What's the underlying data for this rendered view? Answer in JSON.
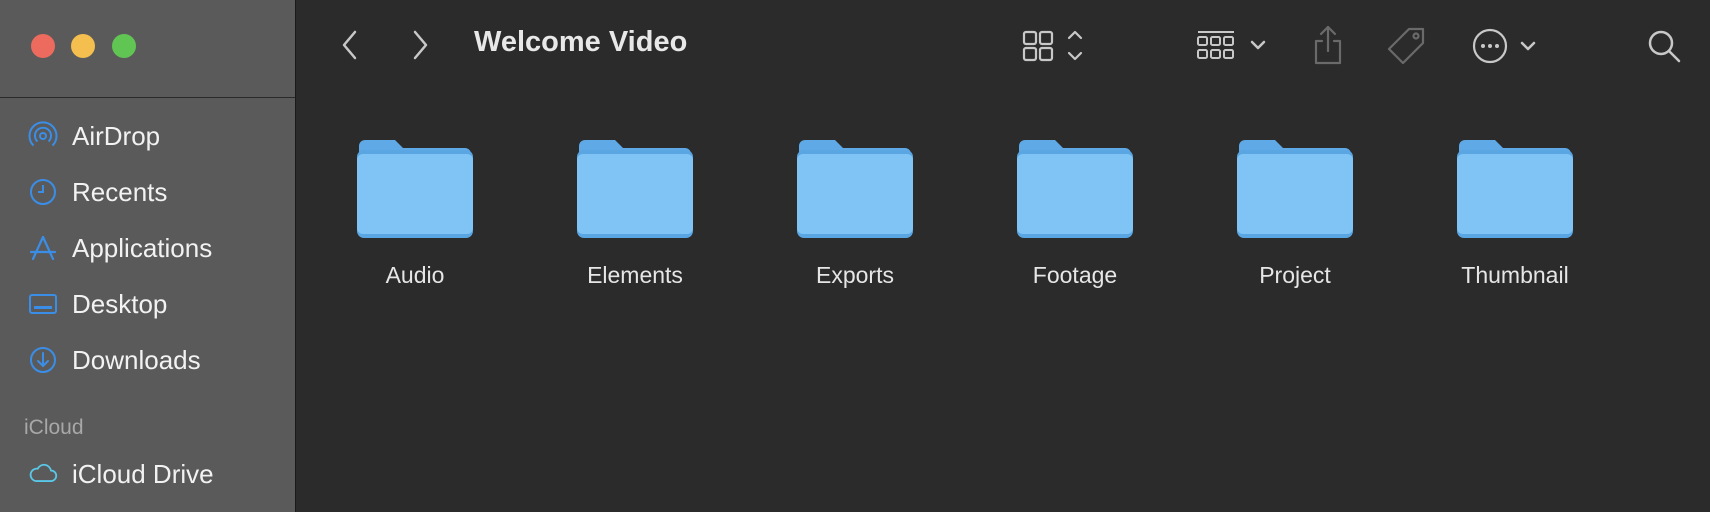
{
  "window": {
    "title": "Welcome Video"
  },
  "sidebar": {
    "favorites": [
      {
        "label": "AirDrop",
        "icon": "airdrop-icon"
      },
      {
        "label": "Recents",
        "icon": "clock-icon"
      },
      {
        "label": "Applications",
        "icon": "applications-icon"
      },
      {
        "label": "Desktop",
        "icon": "desktop-icon"
      },
      {
        "label": "Downloads",
        "icon": "download-icon"
      }
    ],
    "icloud_section": "iCloud",
    "icloud": [
      {
        "label": "iCloud Drive",
        "icon": "cloud-icon"
      }
    ]
  },
  "folders": [
    {
      "name": "Audio"
    },
    {
      "name": "Elements"
    },
    {
      "name": "Exports"
    },
    {
      "name": "Footage"
    },
    {
      "name": "Project"
    },
    {
      "name": "Thumbnail"
    }
  ],
  "colors": {
    "accent": "#3b8ee8",
    "folder_body": "#7fc4f5",
    "folder_back": "#5ea9e6"
  }
}
